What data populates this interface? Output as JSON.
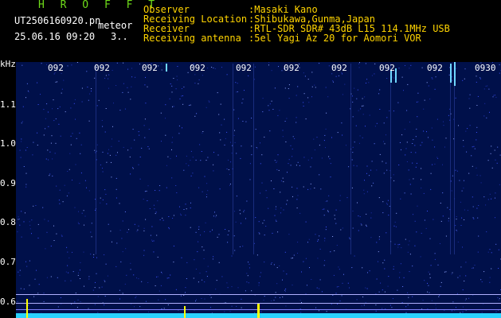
{
  "header": {
    "brand": "H R O F F T",
    "file_name": "UT2506160920.pn",
    "mode": "meteor",
    "date_time": "25.06.16 09:20",
    "page": "3.."
  },
  "station_info": [
    {
      "key": "Observer",
      "value": ":Masaki Kano"
    },
    {
      "key": "Receiving Location",
      "value": ":Shibukawa,Gunma,Japan"
    },
    {
      "key": "Receiver",
      "value": ":RTL-SDR SDR# 43dB L15 114.1MHz USB"
    },
    {
      "key": "Receiving antenna",
      "value": ":5el Yagi Az 20 for Aomori VOR"
    }
  ],
  "axis": {
    "y_unit": "kHz",
    "y_ticks": [
      "1.1",
      "1.0",
      "0.9",
      "0.8",
      "0.7",
      "0.6"
    ],
    "x_ticks": [
      "092",
      "092",
      "092",
      "092",
      "092",
      "092",
      "092",
      "092",
      "092",
      "0930"
    ]
  },
  "colors": {
    "background": "#000000",
    "spectrum_bg": "#00104a",
    "brand": "#6fdc1a",
    "info_text": "#ffd400",
    "marker": "#ffff00"
  }
}
